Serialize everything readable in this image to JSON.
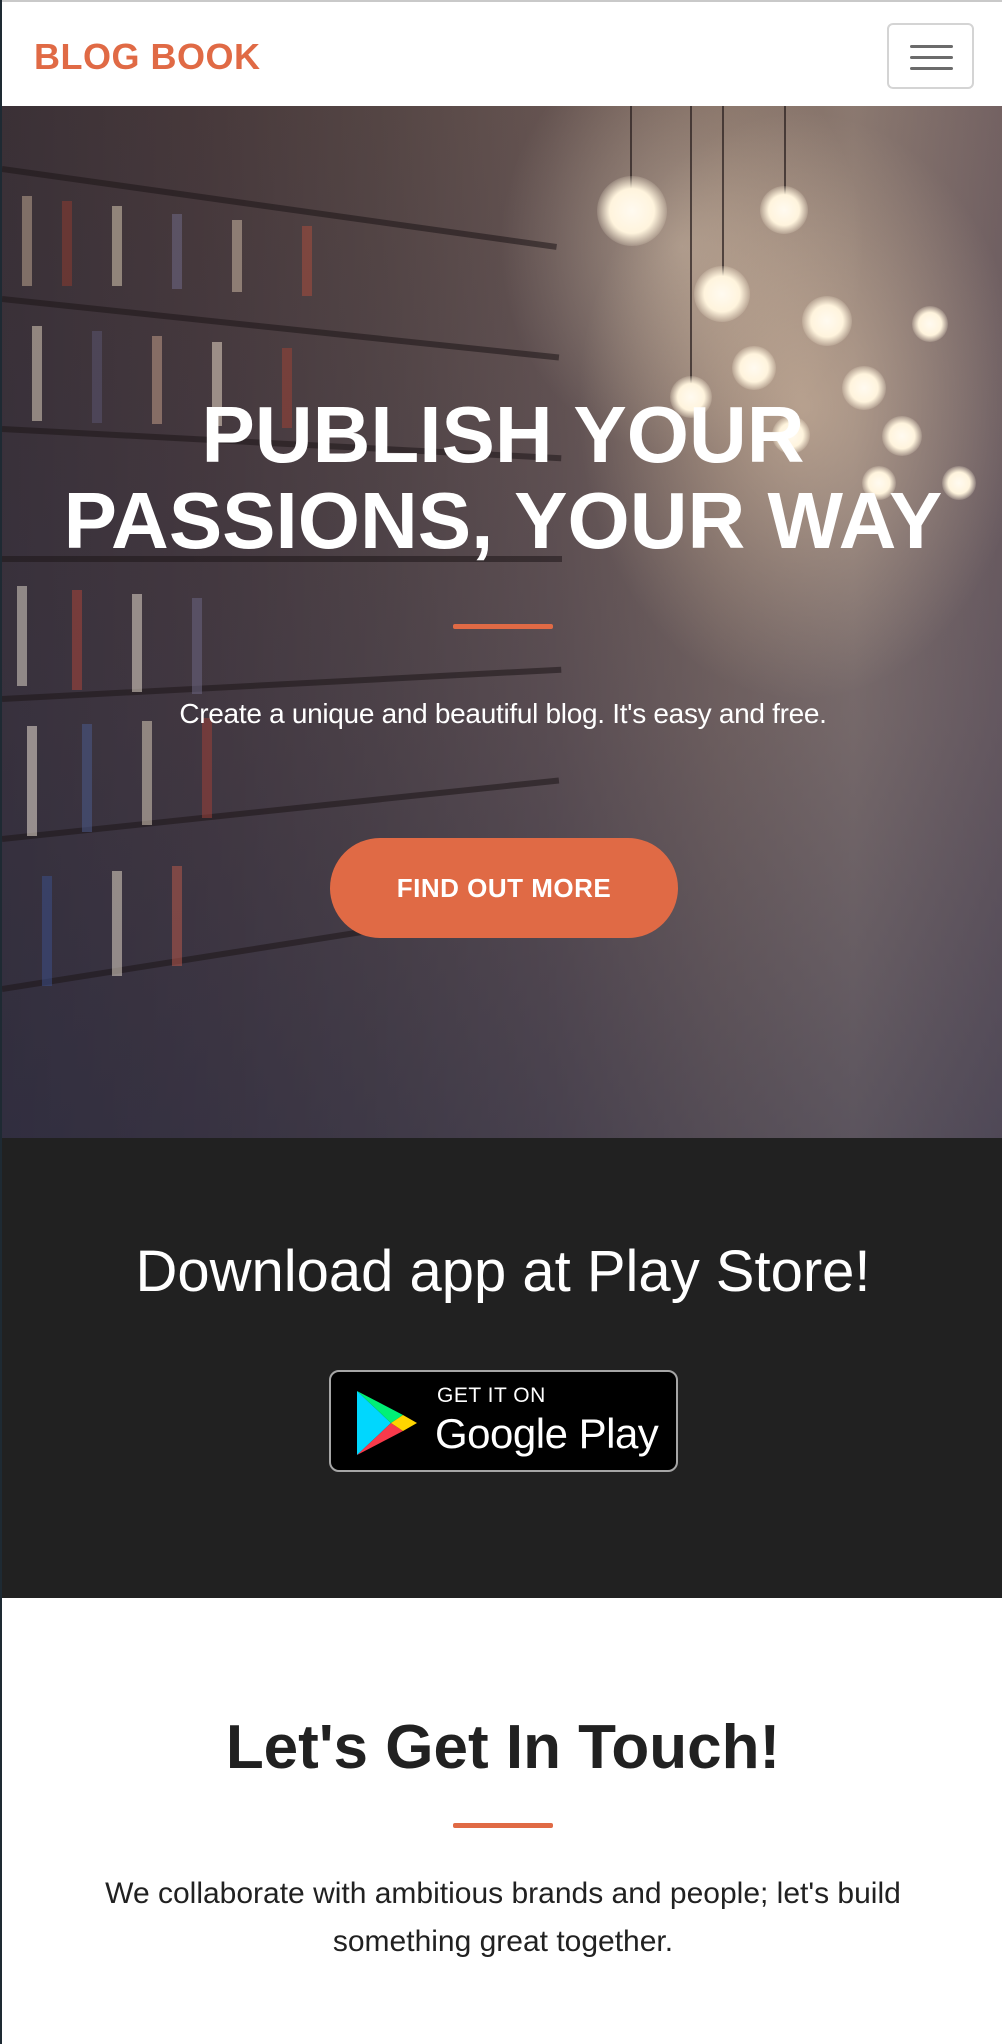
{
  "navbar": {
    "brand": "BLOG BOOK",
    "menu_icon": "hamburger-menu-icon"
  },
  "hero": {
    "title": "PUBLISH YOUR PASSIONS, YOUR WAY",
    "subtitle": "Create a unique and beautiful blog. It's easy and free.",
    "cta_label": "FIND OUT MORE"
  },
  "download": {
    "title": "Download app at Play Store!",
    "badge_small": "GET IT ON",
    "badge_big": "Google Play",
    "badge_icon": "google-play-icon"
  },
  "contact": {
    "title": "Let's Get In Touch!",
    "text": "We collaborate with ambitious brands and people; let's build something great together."
  },
  "colors": {
    "accent": "#e06a45",
    "dark_section": "#212121",
    "text": "#212121"
  }
}
